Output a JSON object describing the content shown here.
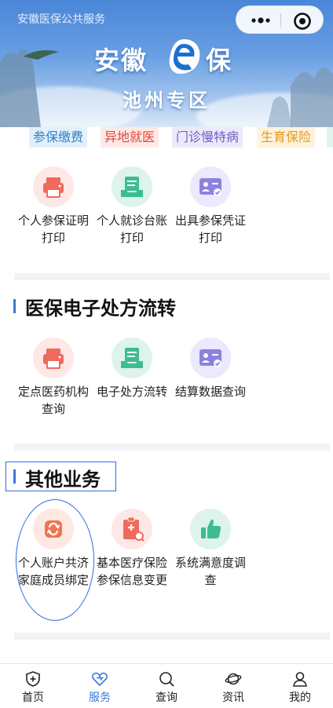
{
  "header": {
    "service_text": "安徽医保公共服务",
    "logo_left": "安徽",
    "logo_right": "保",
    "subtitle": "池州专区"
  },
  "tabs": [
    {
      "label": "参保缴费",
      "bg": "#e3f0fb",
      "color": "#2f7fc8"
    },
    {
      "label": "异地就医",
      "bg": "#fde9e7",
      "color": "#e0463a"
    },
    {
      "label": "门诊慢特病",
      "bg": "#eceafa",
      "color": "#6a5fc8"
    },
    {
      "label": "生育保险",
      "bg": "#fdf2dc",
      "color": "#e39a1e"
    }
  ],
  "sections": {
    "first": {
      "items": [
        {
          "label": "个人参保证明打印",
          "icon": "printer-icon",
          "color": "red"
        },
        {
          "label": "个人就诊台账打印",
          "icon": "document-tray-icon",
          "color": "green"
        },
        {
          "label": "出具参保凭证打印",
          "icon": "id-card-icon",
          "color": "purple"
        }
      ]
    },
    "prescription": {
      "title": "医保电子处方流转",
      "items": [
        {
          "label": "定点医药机构查询",
          "icon": "printer-icon",
          "color": "red"
        },
        {
          "label": "电子处方流转",
          "icon": "document-tray-icon",
          "color": "green"
        },
        {
          "label": "结算数据查询",
          "icon": "id-card-icon",
          "color": "purple"
        }
      ]
    },
    "other": {
      "title": "其他业务",
      "items": [
        {
          "label": "个人账户共济家庭成员绑定",
          "icon": "refresh-icon",
          "color": "orange"
        },
        {
          "label": "基本医疗保险参保信息变更",
          "icon": "clipboard-icon",
          "color": "red"
        },
        {
          "label": "系统满意度调查",
          "icon": "thumbs-up-icon",
          "color": "green"
        }
      ]
    }
  },
  "bottom_nav": [
    {
      "label": "首页",
      "icon": "shield-plus-icon",
      "active": false
    },
    {
      "label": "服务",
      "icon": "heart-icon",
      "active": true
    },
    {
      "label": "查询",
      "icon": "search-icon",
      "active": false
    },
    {
      "label": "资讯",
      "icon": "planet-icon",
      "active": false
    },
    {
      "label": "我的",
      "icon": "user-icon",
      "active": false
    }
  ],
  "colors": {
    "accent": "#3b78d8",
    "red_bg": "#fde8e6",
    "red_fg": "#ef6a5c",
    "green_bg": "#ddf3ec",
    "green_fg": "#3dbd8f",
    "purple_bg": "#ebe9fb",
    "purple_fg": "#8b82e0",
    "orange_bg": "#fde8e2",
    "orange_fg": "#ef7452"
  }
}
